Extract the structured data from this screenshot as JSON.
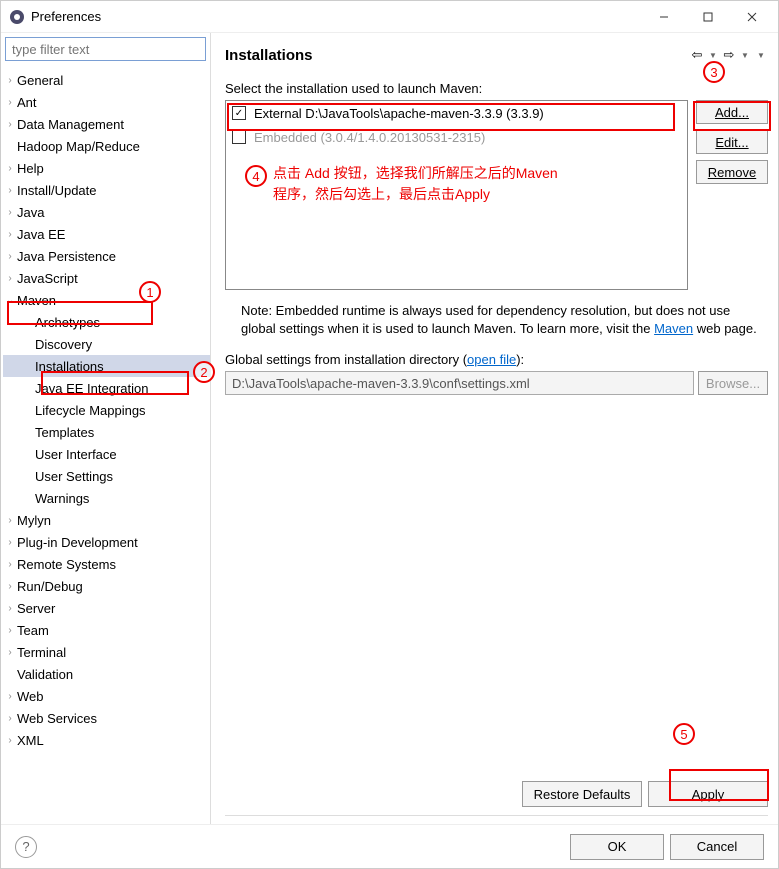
{
  "window": {
    "title": "Preferences"
  },
  "filter": {
    "placeholder": "type filter text"
  },
  "tree": [
    {
      "label": "General",
      "arrow": "›"
    },
    {
      "label": "Ant",
      "arrow": "›"
    },
    {
      "label": "Data Management",
      "arrow": "›"
    },
    {
      "label": "Hadoop Map/Reduce",
      "arrow": ""
    },
    {
      "label": "Help",
      "arrow": "›"
    },
    {
      "label": "Install/Update",
      "arrow": "›"
    },
    {
      "label": "Java",
      "arrow": "›"
    },
    {
      "label": "Java EE",
      "arrow": "›"
    },
    {
      "label": "Java Persistence",
      "arrow": "›"
    },
    {
      "label": "JavaScript",
      "arrow": "›"
    },
    {
      "label": "Maven",
      "arrow": "⌄",
      "expanded": true,
      "children": [
        {
          "label": "Archetypes"
        },
        {
          "label": "Discovery"
        },
        {
          "label": "Installations",
          "selected": true
        },
        {
          "label": "Java EE Integration"
        },
        {
          "label": "Lifecycle Mappings"
        },
        {
          "label": "Templates"
        },
        {
          "label": "User Interface"
        },
        {
          "label": "User Settings"
        },
        {
          "label": "Warnings"
        }
      ]
    },
    {
      "label": "Mylyn",
      "arrow": "›"
    },
    {
      "label": "Plug-in Development",
      "arrow": "›"
    },
    {
      "label": "Remote Systems",
      "arrow": "›"
    },
    {
      "label": "Run/Debug",
      "arrow": "›"
    },
    {
      "label": "Server",
      "arrow": "›"
    },
    {
      "label": "Team",
      "arrow": "›"
    },
    {
      "label": "Terminal",
      "arrow": "›"
    },
    {
      "label": "Validation",
      "arrow": ""
    },
    {
      "label": "Web",
      "arrow": "›"
    },
    {
      "label": "Web Services",
      "arrow": "›"
    },
    {
      "label": "XML",
      "arrow": "›"
    }
  ],
  "right": {
    "heading": "Installations",
    "select_label": "Select the installation used to launch Maven:",
    "rows": [
      {
        "checked": true,
        "label": "External D:\\JavaTools\\apache-maven-3.3.9 (3.3.9)"
      },
      {
        "checked": false,
        "label": "Embedded (3.0.4/1.4.0.20130531-2315)",
        "disabled": true
      }
    ],
    "buttons": {
      "add": "Add...",
      "edit": "Edit...",
      "remove": "Remove"
    },
    "note_prefix": "Note: Embedded runtime is always used for dependency resolution, but does not use global settings when it is used to launch Maven. To learn more, visit the ",
    "note_link": "Maven",
    "note_suffix": " web page.",
    "global_label_prefix": "Global settings from installation directory (",
    "global_label_link": "open file",
    "global_label_suffix": "):",
    "global_value": "D:\\JavaTools\\apache-maven-3.3.9\\conf\\settings.xml",
    "browse": "Browse...",
    "restore": "Restore Defaults",
    "apply": "Apply"
  },
  "bottom": {
    "ok": "OK",
    "cancel": "Cancel"
  },
  "annotations": {
    "n1": "1",
    "n2": "2",
    "n3": "3",
    "n4": "4",
    "n5": "5",
    "text1": "点击 Add 按钮，选择我们所解压之后的Maven",
    "text2": "程序，然后勾选上，最后点击Apply"
  }
}
